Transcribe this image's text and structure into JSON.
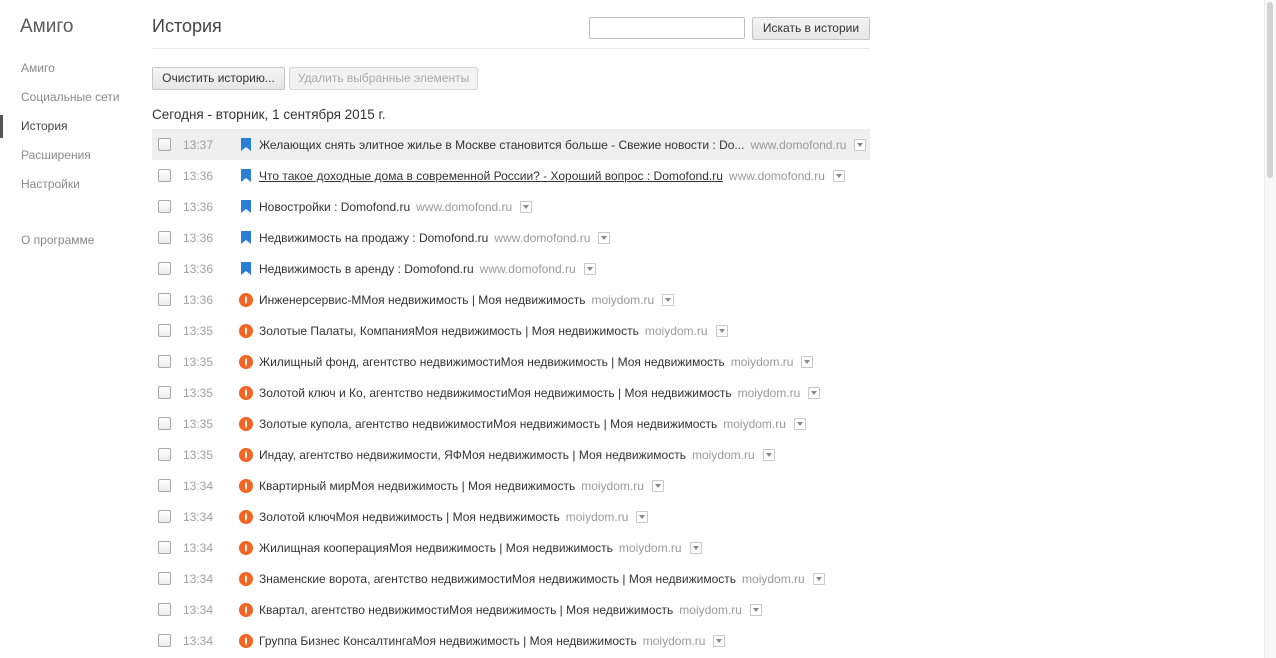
{
  "sidebar": {
    "app_title": "Амиго",
    "items": [
      {
        "label": "Амиго"
      },
      {
        "label": "Социальные сети"
      },
      {
        "label": "История",
        "active": true
      },
      {
        "label": "Расширения"
      },
      {
        "label": "Настройки"
      },
      {
        "label": "О программе"
      }
    ]
  },
  "header": {
    "title": "История",
    "search_placeholder": "",
    "search_button": "Искать в истории"
  },
  "toolbar": {
    "clear_button": "Очистить историю...",
    "delete_button": "Удалить выбранные элементы"
  },
  "date_heading": "Сегодня - вторник, 1 сентября 2015 г.",
  "colors": {
    "bookmark": "#2a7fd4",
    "moiydom": "#f26522"
  },
  "entries": [
    {
      "time": "13:37",
      "icon": "bookmark-icon",
      "title": "Желающих снять элитное жилье в Москве становится больше - Свежие новости : Do...",
      "domain": "www.domofond.ru",
      "highlighted": true
    },
    {
      "time": "13:36",
      "icon": "bookmark-icon",
      "title": "Что такое доходные дома в современной России? - Хороший вопрос : Domofond.ru",
      "domain": "www.domofond.ru",
      "link": true
    },
    {
      "time": "13:36",
      "icon": "bookmark-icon",
      "title": "Новостройки : Domofond.ru",
      "domain": "www.domofond.ru"
    },
    {
      "time": "13:36",
      "icon": "bookmark-icon",
      "title": "Недвижимость на продажу : Domofond.ru",
      "domain": "www.domofond.ru"
    },
    {
      "time": "13:36",
      "icon": "bookmark-icon",
      "title": "Недвижимость в аренду : Domofond.ru",
      "domain": "www.domofond.ru"
    },
    {
      "time": "13:36",
      "icon": "moiydom-icon",
      "title": "Инженерсервис-ММоя недвижимость | Моя недвижимость",
      "domain": "moiydom.ru"
    },
    {
      "time": "13:35",
      "icon": "moiydom-icon",
      "title": "Золотые Палаты, КомпанияМоя недвижимость | Моя недвижимость",
      "domain": "moiydom.ru"
    },
    {
      "time": "13:35",
      "icon": "moiydom-icon",
      "title": "Жилищный фонд, агентство недвижимостиМоя недвижимость | Моя недвижимость",
      "domain": "moiydom.ru"
    },
    {
      "time": "13:35",
      "icon": "moiydom-icon",
      "title": "Золотой ключ и Ко, агентство недвижимостиМоя недвижимость | Моя недвижимость",
      "domain": "moiydom.ru"
    },
    {
      "time": "13:35",
      "icon": "moiydom-icon",
      "title": "Золотые купола, агентство недвижимостиМоя недвижимость | Моя недвижимость",
      "domain": "moiydom.ru"
    },
    {
      "time": "13:35",
      "icon": "moiydom-icon",
      "title": "Индау, агентство недвижимости, ЯФМоя недвижимость | Моя недвижимость",
      "domain": "moiydom.ru"
    },
    {
      "time": "13:34",
      "icon": "moiydom-icon",
      "title": "Квартирный мирМоя недвижимость | Моя недвижимость",
      "domain": "moiydom.ru"
    },
    {
      "time": "13:34",
      "icon": "moiydom-icon",
      "title": "Золотой ключМоя недвижимость | Моя недвижимость",
      "domain": "moiydom.ru"
    },
    {
      "time": "13:34",
      "icon": "moiydom-icon",
      "title": "Жилищная кооперацияМоя недвижимость | Моя недвижимость",
      "domain": "moiydom.ru"
    },
    {
      "time": "13:34",
      "icon": "moiydom-icon",
      "title": "Знаменские ворота, агентство недвижимостиМоя недвижимость | Моя недвижимость",
      "domain": "moiydom.ru"
    },
    {
      "time": "13:34",
      "icon": "moiydom-icon",
      "title": "Квартал, агентство недвижимостиМоя недвижимость | Моя недвижимость",
      "domain": "moiydom.ru"
    },
    {
      "time": "13:34",
      "icon": "moiydom-icon",
      "title": "Группа Бизнес КонсалтингаМоя недвижимость | Моя недвижимость",
      "domain": "moiydom.ru"
    }
  ]
}
